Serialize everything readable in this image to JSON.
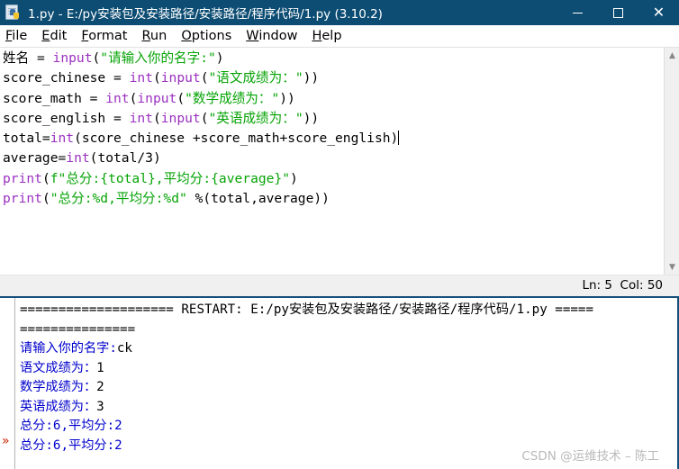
{
  "window": {
    "title": "1.py - E:/py安装包及安装路径/安装路径/程序代码/1.py (3.10.2)",
    "icon": "python-file-icon",
    "controls": {
      "minimize": "minimize-icon",
      "maximize": "maximize-icon",
      "close": "close-icon"
    }
  },
  "menubar": {
    "items": [
      {
        "accel": "F",
        "rest": "ile"
      },
      {
        "accel": "E",
        "rest": "dit"
      },
      {
        "accel": "F",
        "rest": "ormat",
        "pre": ""
      },
      {
        "accel": "R",
        "rest": "un"
      },
      {
        "accel": "O",
        "rest": "ptions"
      },
      {
        "accel": "W",
        "rest": "indow"
      },
      {
        "accel": "H",
        "rest": "elp"
      }
    ],
    "labels": [
      "File",
      "Edit",
      "Format",
      "Run",
      "Options",
      "Window",
      "Help"
    ]
  },
  "editor": {
    "lines": [
      [
        {
          "t": "姓名 = ",
          "c": "plain"
        },
        {
          "t": "input",
          "c": "builtin"
        },
        {
          "t": "(",
          "c": "plain"
        },
        {
          "t": "\"请输入你的名字:\"",
          "c": "string"
        },
        {
          "t": ")",
          "c": "plain"
        }
      ],
      [
        {
          "t": "score_chinese = ",
          "c": "plain"
        },
        {
          "t": "int",
          "c": "builtin"
        },
        {
          "t": "(",
          "c": "plain"
        },
        {
          "t": "input",
          "c": "builtin"
        },
        {
          "t": "(",
          "c": "plain"
        },
        {
          "t": "\"语文成绩为：\"",
          "c": "string"
        },
        {
          "t": "))",
          "c": "plain"
        }
      ],
      [
        {
          "t": "score_math = ",
          "c": "plain"
        },
        {
          "t": "int",
          "c": "builtin"
        },
        {
          "t": "(",
          "c": "plain"
        },
        {
          "t": "input",
          "c": "builtin"
        },
        {
          "t": "(",
          "c": "plain"
        },
        {
          "t": "\"数学成绩为：\"",
          "c": "string"
        },
        {
          "t": "))",
          "c": "plain"
        }
      ],
      [
        {
          "t": "score_english = ",
          "c": "plain"
        },
        {
          "t": "int",
          "c": "builtin"
        },
        {
          "t": "(",
          "c": "plain"
        },
        {
          "t": "input",
          "c": "builtin"
        },
        {
          "t": "(",
          "c": "plain"
        },
        {
          "t": "\"英语成绩为：\"",
          "c": "string"
        },
        {
          "t": "))",
          "c": "plain"
        }
      ],
      [
        {
          "t": "total=",
          "c": "plain"
        },
        {
          "t": "int",
          "c": "builtin"
        },
        {
          "t": "(score_chinese +score_math+score_english)",
          "c": "plain"
        },
        {
          "t": "",
          "c": "caret"
        }
      ],
      [
        {
          "t": "average=",
          "c": "plain"
        },
        {
          "t": "int",
          "c": "builtin"
        },
        {
          "t": "(total/3)",
          "c": "plain"
        }
      ],
      [
        {
          "t": "print",
          "c": "builtin"
        },
        {
          "t": "(",
          "c": "plain"
        },
        {
          "t": "f\"总分:{total},平均分:{average}\"",
          "c": "string"
        },
        {
          "t": ")",
          "c": "plain"
        }
      ],
      [
        {
          "t": "print",
          "c": "builtin"
        },
        {
          "t": "(",
          "c": "plain"
        },
        {
          "t": "\"总分:%d,平均分:%d\"",
          "c": "string"
        },
        {
          "t": " %(total,average))",
          "c": "plain"
        }
      ]
    ]
  },
  "statusbar": {
    "position": "Ln: 5  Col: 50",
    "line": "5",
    "col": "50"
  },
  "shell": {
    "lines": [
      [
        {
          "t": "==================== RESTART: E:/py安装包及安装路径/安装路径/程序代码/1.py =====",
          "c": "rst"
        }
      ],
      [
        {
          "t": "===============",
          "c": "rst"
        }
      ],
      [
        {
          "t": "请输入你的名字:",
          "c": "prompt"
        },
        {
          "t": "ck",
          "c": "value"
        }
      ],
      [
        {
          "t": "语文成绩为：",
          "c": "prompt"
        },
        {
          "t": "1",
          "c": "value"
        }
      ],
      [
        {
          "t": "数学成绩为：",
          "c": "prompt"
        },
        {
          "t": "2",
          "c": "value"
        }
      ],
      [
        {
          "t": "英语成绩为：",
          "c": "prompt"
        },
        {
          "t": "3",
          "c": "value"
        }
      ],
      [
        {
          "t": "总分:6,平均分:2",
          "c": "prompt"
        }
      ],
      [
        {
          "t": "总分:6,平均分:2",
          "c": "prompt"
        }
      ]
    ],
    "marker": "»"
  },
  "scrollbar": {
    "up": "chevron-up-icon",
    "down": "chevron-down-icon"
  },
  "watermark": {
    "text": "CSDN @运维技术 – 陈工"
  },
  "colors": {
    "titlebar": "#0d4d73",
    "builtin": "#9b30c0",
    "string": "#06a406",
    "shell_prompt": "#0000cc",
    "divider": "#14507a"
  }
}
